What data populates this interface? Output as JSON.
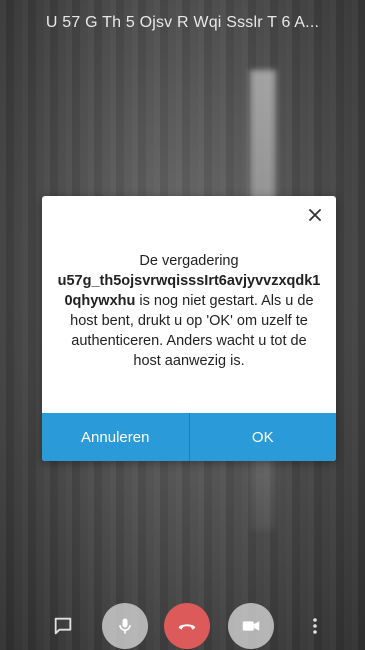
{
  "header": {
    "meeting_title": "U 57 G Th 5 Ojsv R Wqi Ssslr T 6 A..."
  },
  "dialog": {
    "text_line1": "De vergadering",
    "meeting_id": "u57g_th5ojsvrwqisssIrt6avjyvvzxqdk10qhywxhu",
    "text_rest": " is nog niet gestart. Als u de host bent, drukt u op 'OK' om uzelf te authenticeren. Anders wacht u tot de host aanwezig is.",
    "cancel_label": "Annuleren",
    "ok_label": "OK",
    "close_icon": "close-icon"
  },
  "toolbar": {
    "icons": [
      "chat-icon",
      "microphone-icon",
      "hangup-icon",
      "camera-icon",
      "more-vertical-icon"
    ]
  },
  "colors": {
    "accent": "#2b9ad8",
    "hangup": "#dd5a5a"
  }
}
